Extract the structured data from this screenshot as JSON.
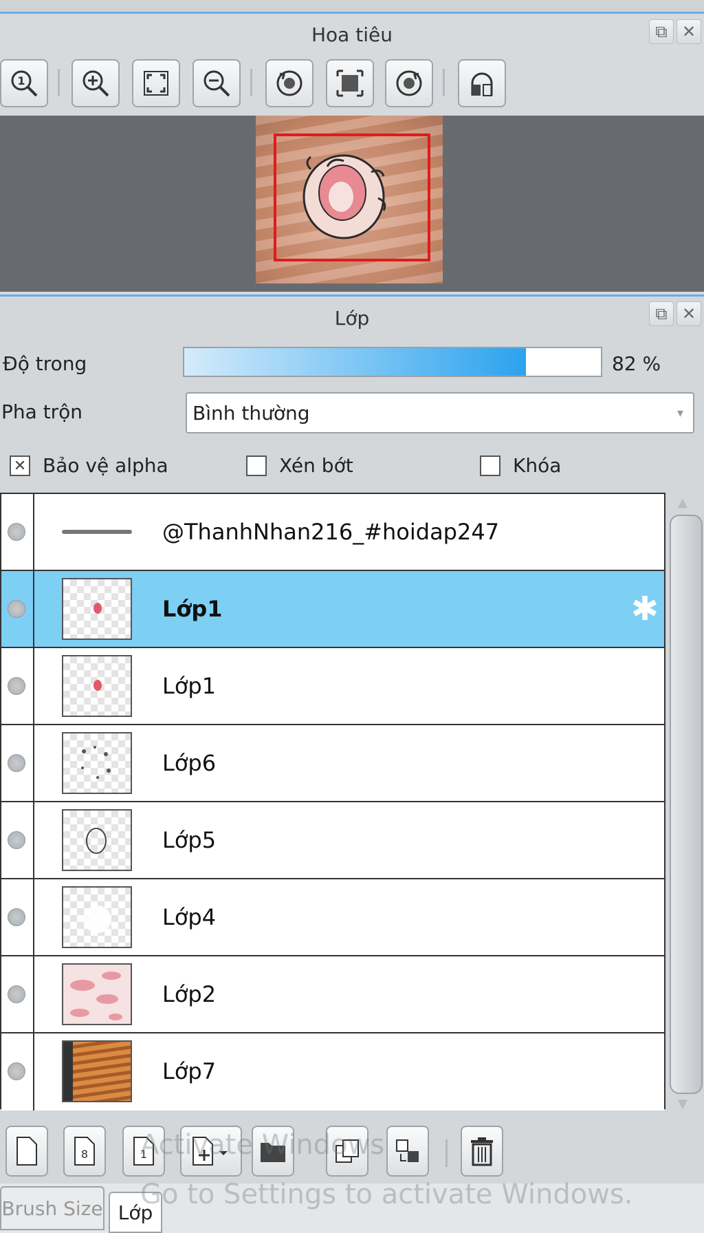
{
  "navigator": {
    "title": "Hoa tiêu",
    "tools": [
      "zoom-actual-icon",
      "zoom-in-icon",
      "fit-screen-icon",
      "zoom-out-icon",
      "rotate-left-icon",
      "reset-view-icon",
      "rotate-right-icon",
      "flip-horizontal-icon"
    ]
  },
  "layers_panel": {
    "title": "Lớp",
    "opacity_label": "Độ trong",
    "opacity_value_text": "82 %",
    "opacity_value": 82,
    "blend_label": "Pha trộn",
    "blend_value": "Bình thường",
    "protect_alpha_label": "Bảo vệ alpha",
    "clip_label": "Xén bớt",
    "lock_label": "Khóa",
    "layers": [
      {
        "name": "@ThanhNhan216_#hoidap247",
        "selected": false,
        "thumb": "text-line"
      },
      {
        "name": "Lớp1",
        "selected": true,
        "thumb": "pink-dot"
      },
      {
        "name": "Lớp1",
        "selected": false,
        "thumb": "pink-dot"
      },
      {
        "name": "Lớp6",
        "selected": false,
        "thumb": "sketch-dots"
      },
      {
        "name": "Lớp5",
        "selected": false,
        "thumb": "outline"
      },
      {
        "name": "Lớp4",
        "selected": false,
        "thumb": "empty"
      },
      {
        "name": "Lớp2",
        "selected": false,
        "thumb": "pink-pattern"
      },
      {
        "name": "Lớp7",
        "selected": false,
        "thumb": "orange-stripes"
      }
    ],
    "toolbar": [
      "new-layer-icon",
      "new-8bit-layer-icon",
      "new-1bit-layer-icon",
      "add-layer-menu-icon",
      "new-folder-icon",
      "duplicate-layer-icon",
      "merge-layer-icon",
      "delete-layer-icon"
    ]
  },
  "bottom_tabs": [
    "Brush Size",
    "Lớp"
  ],
  "watermark": {
    "line1": "Activate Windows",
    "line2": "Go to Settings to activate Windows."
  },
  "colors": {
    "accent": "#2ba3ee",
    "selection": "#7ecff4",
    "frame": "#e01b1b"
  }
}
